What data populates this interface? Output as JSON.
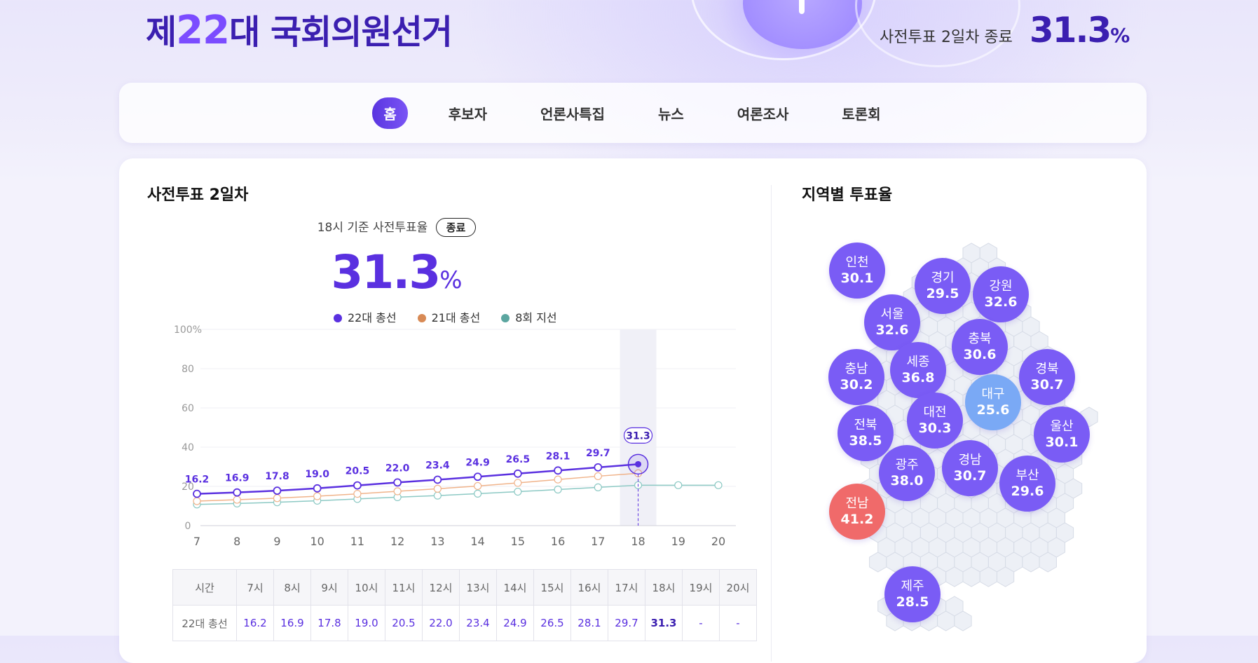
{
  "header": {
    "logo_prefix": "제",
    "logo_number": "22",
    "logo_suffix": "대 국회의원선거",
    "summary_label": "사전투표 2일차 종료",
    "summary_value": "31.3",
    "summary_unit": "%"
  },
  "nav": {
    "items": [
      "홈",
      "후보자",
      "언론사특집",
      "뉴스",
      "여론조사",
      "토론회"
    ],
    "active_index": 0
  },
  "turnout": {
    "section_title": "사전투표 2일차",
    "subtitle": "18시 기준 사전투표율",
    "status_badge": "종료",
    "value": "31.3",
    "unit": "%"
  },
  "legend": [
    {
      "label": "22대 총선",
      "color": "#5a30e0"
    },
    {
      "label": "21대 총선",
      "color": "#d88a55"
    },
    {
      "label": "8회 지선",
      "color": "#5ba6a0"
    }
  ],
  "chart_data": {
    "type": "line",
    "x": [
      7,
      8,
      9,
      10,
      11,
      12,
      13,
      14,
      15,
      16,
      17,
      18,
      19,
      20
    ],
    "ylim": [
      0,
      100
    ],
    "yticks": [
      "100%",
      "80",
      "60",
      "40",
      "20",
      "0"
    ],
    "highlight_x": 18,
    "series": [
      {
        "name": "22대 총선",
        "color": "#5a30e0",
        "values": [
          16.2,
          16.9,
          17.8,
          19.0,
          20.5,
          22.0,
          23.4,
          24.9,
          26.5,
          28.1,
          29.7,
          31.3,
          null,
          null
        ],
        "labels": [
          "16.2",
          "16.9",
          "17.8",
          "19.0",
          "20.5",
          "22.0",
          "23.4",
          "24.9",
          "26.5",
          "28.1",
          "29.7",
          "31.3"
        ]
      },
      {
        "name": "21대 총선",
        "color": "#f0b38a",
        "values": [
          12.5,
          13.2,
          14.0,
          15.0,
          16.2,
          17.5,
          18.8,
          20.2,
          21.8,
          23.5,
          25.2,
          26.7,
          null,
          null
        ]
      },
      {
        "name": "8회 지선",
        "color": "#8cc9c4",
        "values": [
          10.8,
          11.3,
          11.9,
          12.7,
          13.6,
          14.5,
          15.3,
          16.3,
          17.3,
          18.4,
          19.5,
          20.6,
          20.6,
          20.6
        ]
      }
    ]
  },
  "table": {
    "header_label": "시간",
    "columns": [
      "7시",
      "8시",
      "9시",
      "10시",
      "11시",
      "12시",
      "13시",
      "14시",
      "15시",
      "16시",
      "17시",
      "18시",
      "19시",
      "20시"
    ],
    "row_label": "22대 총선",
    "values": [
      "16.2",
      "16.9",
      "17.8",
      "19.0",
      "20.5",
      "22.0",
      "23.4",
      "24.9",
      "26.5",
      "28.1",
      "29.7",
      "31.3",
      "-",
      "-"
    ],
    "current_index": 11
  },
  "map": {
    "section_title": "지역별 투표율",
    "normal_color": "#7a5cf5",
    "low_color": "#7aa9f5",
    "high_color": "#f06a6a",
    "regions": [
      {
        "name": "인천",
        "value": "30.1",
        "level": "normal"
      },
      {
        "name": "경기",
        "value": "29.5",
        "level": "normal"
      },
      {
        "name": "강원",
        "value": "32.6",
        "level": "normal"
      },
      {
        "name": "서울",
        "value": "32.6",
        "level": "normal"
      },
      {
        "name": "충북",
        "value": "30.6",
        "level": "normal"
      },
      {
        "name": "세종",
        "value": "36.8",
        "level": "normal"
      },
      {
        "name": "충남",
        "value": "30.2",
        "level": "normal"
      },
      {
        "name": "경북",
        "value": "30.7",
        "level": "normal"
      },
      {
        "name": "대구",
        "value": "25.6",
        "level": "low"
      },
      {
        "name": "대전",
        "value": "30.3",
        "level": "normal"
      },
      {
        "name": "전북",
        "value": "38.5",
        "level": "normal"
      },
      {
        "name": "울산",
        "value": "30.1",
        "level": "normal"
      },
      {
        "name": "경남",
        "value": "30.7",
        "level": "normal"
      },
      {
        "name": "광주",
        "value": "38.0",
        "level": "normal"
      },
      {
        "name": "부산",
        "value": "29.6",
        "level": "normal"
      },
      {
        "name": "전남",
        "value": "41.2",
        "level": "high"
      },
      {
        "name": "제주",
        "value": "28.5",
        "level": "normal"
      }
    ]
  }
}
